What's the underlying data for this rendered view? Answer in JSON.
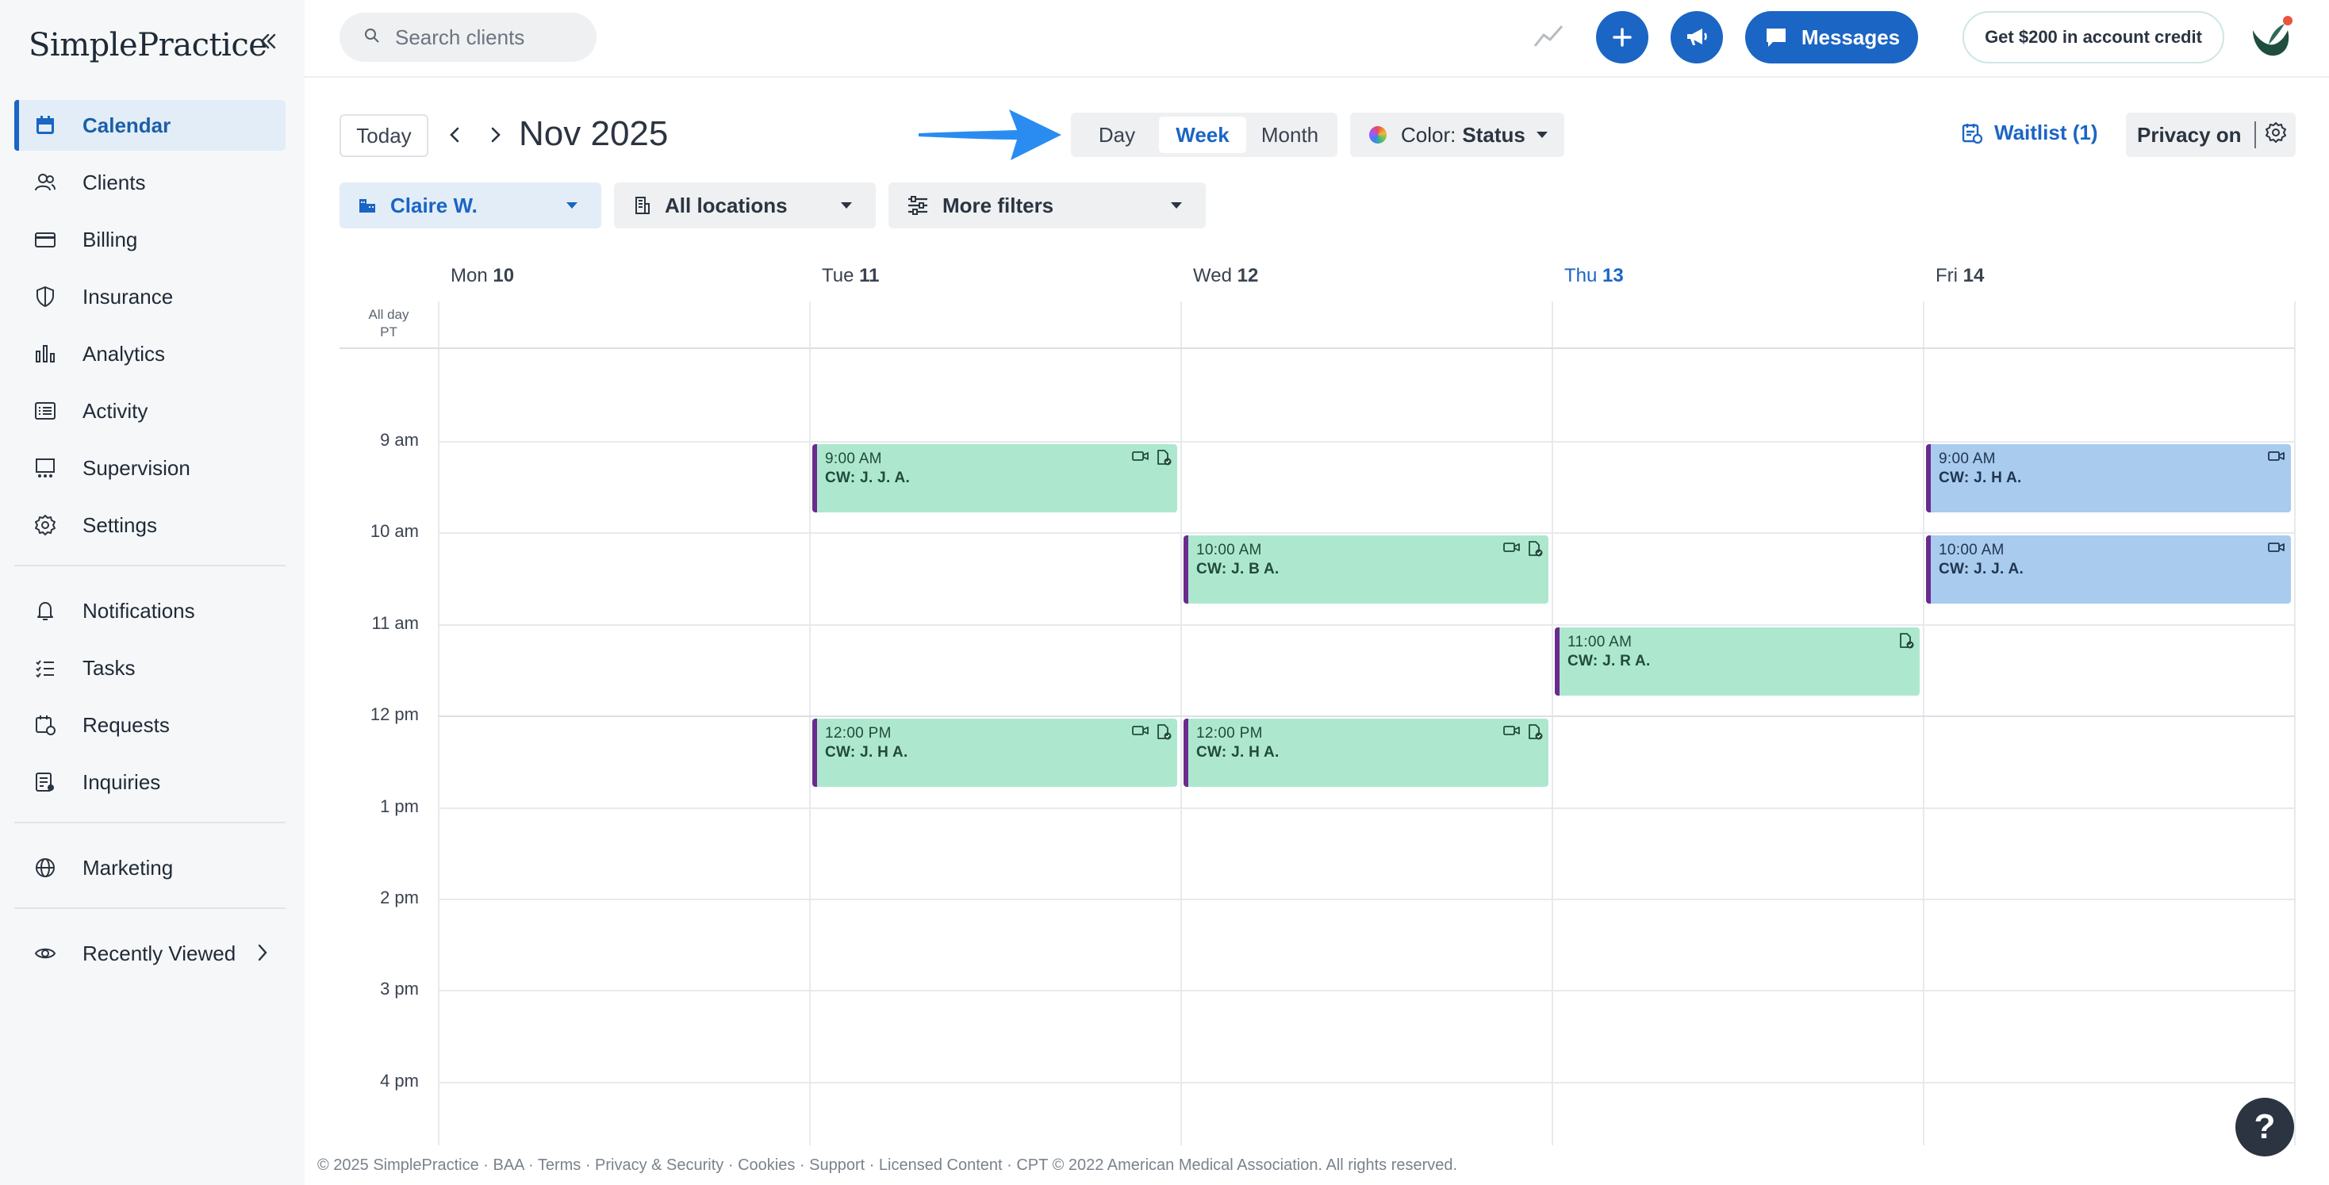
{
  "app": {
    "logo": "SimplePractice"
  },
  "sidebar": {
    "items": [
      {
        "label": "Calendar",
        "icon": "calendar-icon",
        "active": true
      },
      {
        "label": "Clients",
        "icon": "clients-icon"
      },
      {
        "label": "Billing",
        "icon": "billing-card-icon"
      },
      {
        "label": "Insurance",
        "icon": "shield-icon"
      },
      {
        "label": "Analytics",
        "icon": "bar-chart-icon"
      },
      {
        "label": "Activity",
        "icon": "activity-list-icon"
      },
      {
        "label": "Supervision",
        "icon": "supervision-icon"
      },
      {
        "label": "Settings",
        "icon": "gear-icon"
      }
    ],
    "items2": [
      {
        "label": "Notifications",
        "icon": "bell-icon"
      },
      {
        "label": "Tasks",
        "icon": "tasks-icon"
      },
      {
        "label": "Requests",
        "icon": "requests-icon"
      },
      {
        "label": "Inquiries",
        "icon": "inquiries-icon"
      }
    ],
    "items3": [
      {
        "label": "Marketing",
        "icon": "globe-icon"
      },
      {
        "label": "Recently Viewed",
        "icon": "eye-icon"
      }
    ]
  },
  "topbar": {
    "search_placeholder": "Search clients",
    "messages_label": "Messages",
    "credit_label": "Get $200 in account credit"
  },
  "calendar": {
    "today_label": "Today",
    "month_title": "Nov 2025",
    "views": {
      "day": "Day",
      "week": "Week",
      "month": "Month",
      "selected": "Week"
    },
    "color_label": "Color:",
    "color_value": "Status",
    "waitlist_label": "Waitlist (1)",
    "privacy_label": "Privacy on",
    "filters": {
      "clinician": "Claire W.",
      "locations": "All locations",
      "more": "More filters"
    },
    "allday_label": "All day",
    "timezone": "PT",
    "days": [
      {
        "name": "Mon",
        "num": "10"
      },
      {
        "name": "Tue",
        "num": "11"
      },
      {
        "name": "Wed",
        "num": "12"
      },
      {
        "name": "Thu",
        "num": "13",
        "today": true
      },
      {
        "name": "Fri",
        "num": "14"
      }
    ],
    "hours": [
      "9 am",
      "10 am",
      "11 am",
      "12 pm",
      "1 pm",
      "2 pm",
      "3 pm",
      "4 pm"
    ],
    "events": [
      {
        "day": 1,
        "time": "9:00 AM",
        "name": "CW: J. J. A.",
        "color": "green",
        "video": true,
        "doc": true
      },
      {
        "day": 1,
        "time": "12:00 PM",
        "name": "CW: J. H A.",
        "color": "green",
        "video": true,
        "doc": true
      },
      {
        "day": 2,
        "time": "10:00 AM",
        "name": "CW: J. B A.",
        "color": "green",
        "video": true,
        "doc": true
      },
      {
        "day": 2,
        "time": "12:00 PM",
        "name": "CW: J. H A.",
        "color": "green",
        "video": true,
        "doc": true
      },
      {
        "day": 3,
        "time": "11:00 AM",
        "name": "CW: J. R A.",
        "color": "green",
        "video": false,
        "doc": true
      },
      {
        "day": 4,
        "time": "9:00 AM",
        "name": "CW: J. H A.",
        "color": "blue",
        "video": true,
        "doc": false
      },
      {
        "day": 4,
        "time": "10:00 AM",
        "name": "CW: J. J. A.",
        "color": "blue",
        "video": true,
        "doc": false
      }
    ]
  },
  "footer": {
    "text": "© 2025 SimplePractice · BAA · Terms · Privacy & Security · Cookies · Support · Licensed Content · CPT © 2022 American Medical Association. All rights reserved."
  },
  "help_label": "?"
}
